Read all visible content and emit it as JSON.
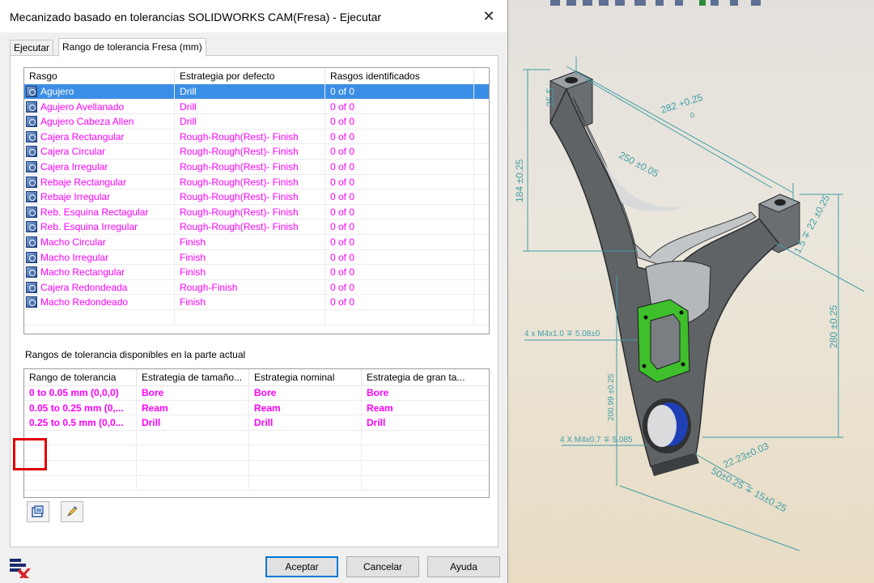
{
  "dialog": {
    "title": "Mecanizado basado en tolerancias SOLIDWORKS CAM(Fresa) - Ejecutar",
    "close_glyph": "✕",
    "tabs": [
      {
        "label": "Ejecutar",
        "active": false
      },
      {
        "label": "Rango de tolerancia Fresa (mm)",
        "active": true
      }
    ]
  },
  "features_table": {
    "headers": [
      "Rasgo",
      "Estrategia por defecto",
      "Rasgos identificados"
    ],
    "rows": [
      {
        "feature": "Agujero",
        "strategy": "Drill",
        "identified": "0 of 0",
        "selected": true
      },
      {
        "feature": "Agujero Avellanado",
        "strategy": "Drill",
        "identified": "0 of 0"
      },
      {
        "feature": "Agujero Cabeza Allen",
        "strategy": "Drill",
        "identified": "0 of 0"
      },
      {
        "feature": "Cajera Rectangular",
        "strategy": "Rough-Rough(Rest)- Finish",
        "identified": "0 of 0"
      },
      {
        "feature": "Cajera Circular",
        "strategy": "Rough-Rough(Rest)- Finish",
        "identified": "0 of 0"
      },
      {
        "feature": "Cajera Irregular",
        "strategy": "Rough-Rough(Rest)- Finish",
        "identified": "0 of 0"
      },
      {
        "feature": "Rebaje Rectangular",
        "strategy": "Rough-Rough(Rest)- Finish",
        "identified": "0 of 0"
      },
      {
        "feature": "Rebaje Irregular",
        "strategy": "Rough-Rough(Rest)- Finish",
        "identified": "0 of 0"
      },
      {
        "feature": "Reb. Esquina Rectagular",
        "strategy": "Rough-Rough(Rest)- Finish",
        "identified": "0 of 0"
      },
      {
        "feature": "Reb. Esquina Irregular",
        "strategy": "Rough-Rough(Rest)- Finish",
        "identified": "0 of 0"
      },
      {
        "feature": "Macho Circular",
        "strategy": "Finish",
        "identified": "0 of 0"
      },
      {
        "feature": "Macho Irregular",
        "strategy": "Finish",
        "identified": "0 of 0"
      },
      {
        "feature": "Macho Rectangular",
        "strategy": "Finish",
        "identified": "0 of 0"
      },
      {
        "feature": "Cajera Redondeada",
        "strategy": "Rough-Finish",
        "identified": "0 of 0"
      },
      {
        "feature": "Macho Redondeado",
        "strategy": "Finish",
        "identified": "0 of 0"
      }
    ]
  },
  "section_label": "Rangos de tolerancia disponibles en la parte actual",
  "tolerance_table": {
    "headers": [
      "Rango de tolerancia",
      "Estrategia de tamaño...",
      "Estrategia nominal",
      "Estrategia de gran ta..."
    ],
    "rows": [
      {
        "range": "0 to 0.05 mm (0,0,0)",
        "small": "Bore",
        "nominal": "Bore",
        "large": "Bore"
      },
      {
        "range": "0.05 to 0.25 mm (0,...",
        "small": "Ream",
        "nominal": "Ream",
        "large": "Ream"
      },
      {
        "range": "0.25 to 0.5 mm (0,0...",
        "small": "Drill",
        "nominal": "Drill",
        "large": "Drill"
      }
    ]
  },
  "toolbar_buttons": {
    "new_icon": "new-range-icon",
    "edit_icon": "edit-pencil-icon"
  },
  "buttons": {
    "accept": "Aceptar",
    "cancel": "Cancelar",
    "help": "Ayuda"
  },
  "viewport": {
    "dimensions": {
      "d1": "282 +0.25",
      "d1b": "0",
      "d2": "250 ±0.05",
      "d3": "184 ±0.25",
      "d4": "25.5",
      "d5": "1.5 ∓ 22 ±0.25",
      "d6": "280 ±0.25",
      "d7": "4 x M4x1.0 ∓ 5.08±0",
      "d8": "200.99 ±0.25",
      "d9": "4 X M4x0.7 ∓ 5.085",
      "d10": "22.23±0.03",
      "d11": "50±0.25 ∓ 15±0.25"
    },
    "colors": {
      "part": "#5f6366",
      "part_light": "#b9bcbf",
      "dimension": "#3f9ea6",
      "green_face": "#3fbf2c",
      "blue_face": "#1e3fb5"
    }
  },
  "colors": {
    "feature_text": "#ff00ff",
    "selection": "#3a8ee6",
    "highlight_box": "#e00000"
  }
}
